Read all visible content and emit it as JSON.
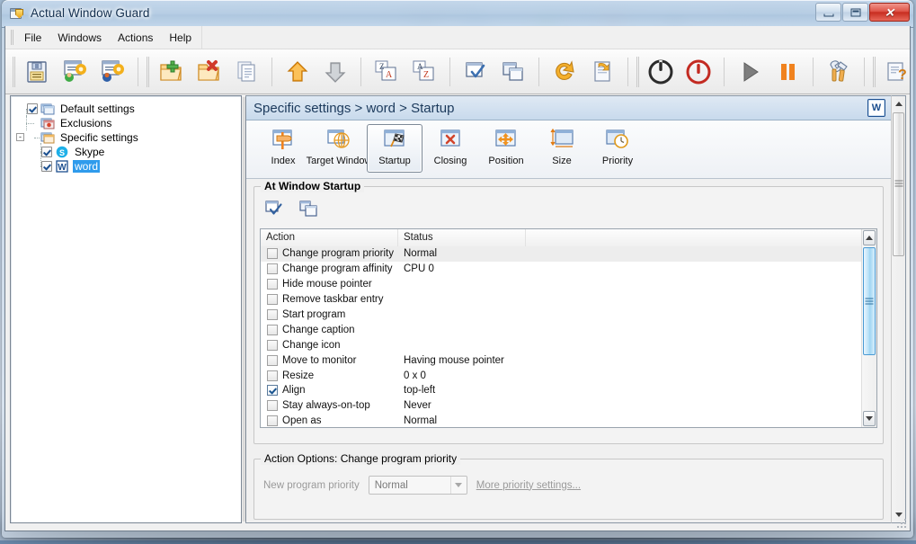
{
  "window": {
    "title": "Actual Window Guard",
    "app_icon": "shield-window-icon",
    "controls": {
      "minimize": "minimize-icon",
      "maximize": "maximize-icon",
      "close": "✕"
    }
  },
  "menubar": {
    "items": [
      "File",
      "Windows",
      "Actions",
      "Help"
    ]
  },
  "toolbar": {
    "groups": [
      {
        "buttons": [
          {
            "name": "save-button",
            "icon": "floppy-disk-icon"
          },
          {
            "name": "default-settings-button",
            "icon": "window-gear-green-icon"
          },
          {
            "name": "specific-settings-button",
            "icon": "window-gear-red-icon"
          }
        ]
      },
      {
        "buttons": [
          {
            "name": "add-rule-button",
            "icon": "folder-plus-icon"
          },
          {
            "name": "delete-rule-button",
            "icon": "folder-delete-icon"
          },
          {
            "name": "copy-rule-button",
            "icon": "copy-pages-icon"
          }
        ]
      },
      {
        "buttons": [
          {
            "name": "move-up-button",
            "icon": "arrow-up-orange-icon"
          },
          {
            "name": "move-down-button",
            "icon": "arrow-down-gray-icon"
          }
        ]
      },
      {
        "buttons": [
          {
            "name": "sort-descending-button",
            "icon": "sort-za-icon"
          },
          {
            "name": "sort-ascending-button",
            "icon": "sort-az-icon"
          }
        ]
      },
      {
        "buttons": [
          {
            "name": "check-all-button",
            "icon": "window-check-icon"
          },
          {
            "name": "uncheck-all-button",
            "icon": "window-copy-icon"
          }
        ]
      },
      {
        "buttons": [
          {
            "name": "undo-button",
            "icon": "undo-arrow-icon"
          },
          {
            "name": "apply-button",
            "icon": "apply-page-icon"
          }
        ]
      },
      {
        "buttons": [
          {
            "name": "enable-button",
            "icon": "power-on-icon"
          },
          {
            "name": "disable-button",
            "icon": "power-off-red-icon"
          }
        ]
      },
      {
        "buttons": [
          {
            "name": "run-button",
            "icon": "play-triangle-icon"
          },
          {
            "name": "pause-button",
            "icon": "pause-bars-icon"
          }
        ]
      },
      {
        "buttons": [
          {
            "name": "tools-button",
            "icon": "hammer-wrench-icon"
          }
        ]
      },
      {
        "buttons": [
          {
            "name": "help-button",
            "icon": "page-question-icon"
          },
          {
            "name": "mail-button",
            "icon": "envelope-green-arrow-icon"
          },
          {
            "name": "support-button",
            "icon": "person-broadcast-icon"
          }
        ]
      }
    ]
  },
  "tree": {
    "nodes": [
      {
        "label": "Default settings",
        "icon": "window-blue-icon",
        "checkbox": "checked",
        "level": 1,
        "expander": "",
        "selected": false
      },
      {
        "label": "Exclusions",
        "icon": "window-red-icon",
        "checkbox": "none",
        "level": 1,
        "expander": "",
        "selected": false
      },
      {
        "label": "Specific settings",
        "icon": "window-orange-icon",
        "checkbox": "none",
        "level": 1,
        "expander": "-",
        "selected": false
      },
      {
        "label": "Skype",
        "icon": "skype-icon",
        "checkbox": "checked",
        "level": 2,
        "expander": "",
        "selected": false
      },
      {
        "label": "word",
        "icon": "word-icon",
        "checkbox": "checked",
        "level": 2,
        "expander": "",
        "selected": true
      }
    ]
  },
  "content": {
    "header_title": "Specific settings > word > Startup",
    "header_badge": "W",
    "tabs": [
      {
        "label": "Index",
        "icon": "window-signpost-icon",
        "active": false
      },
      {
        "label": "Target Window",
        "icon": "window-globe-icon",
        "active": false
      },
      {
        "label": "Startup",
        "icon": "window-flag-icon",
        "active": true
      },
      {
        "label": "Closing",
        "icon": "window-x-icon",
        "active": false
      },
      {
        "label": "Position",
        "icon": "window-move-icon",
        "active": false
      },
      {
        "label": "Size",
        "icon": "window-size-icon",
        "active": false
      },
      {
        "label": "Priority",
        "icon": "window-clock-icon",
        "active": false
      }
    ],
    "startup_group": {
      "legend": "At Window Startup",
      "tools": [
        {
          "name": "check-all-actions-button",
          "icon": "window-check-icon"
        },
        {
          "name": "uncheck-all-actions-button",
          "icon": "window-copy-icon"
        }
      ],
      "columns": [
        "Action",
        "Status",
        ""
      ],
      "rows": [
        {
          "checked": false,
          "action": "Change program priority",
          "status": "Normal",
          "selected": true
        },
        {
          "checked": false,
          "action": "Change program affinity",
          "status": "CPU 0",
          "selected": false
        },
        {
          "checked": false,
          "action": "Hide mouse pointer",
          "status": "",
          "selected": false
        },
        {
          "checked": false,
          "action": "Remove taskbar entry",
          "status": "",
          "selected": false
        },
        {
          "checked": false,
          "action": "Start program",
          "status": "",
          "selected": false
        },
        {
          "checked": false,
          "action": "Change caption",
          "status": "",
          "selected": false
        },
        {
          "checked": false,
          "action": "Change icon",
          "status": "",
          "selected": false
        },
        {
          "checked": false,
          "action": "Move to monitor",
          "status": "Having mouse pointer",
          "selected": false
        },
        {
          "checked": false,
          "action": "Resize",
          "status": "0 x 0",
          "selected": false
        },
        {
          "checked": true,
          "action": "Align",
          "status": "top-left",
          "selected": false
        },
        {
          "checked": false,
          "action": "Stay always-on-top",
          "status": "Never",
          "selected": false
        },
        {
          "checked": false,
          "action": "Open as",
          "status": "Normal",
          "selected": false
        }
      ]
    },
    "options_group": {
      "legend": "Action Options: Change program priority",
      "field_label": "New program priority",
      "field_value": "Normal",
      "link_label": "More priority settings..."
    }
  },
  "colors": {
    "selection_blue": "#2f9bec",
    "header_gradient_top": "#dfe9f4",
    "header_gradient_bottom": "#c8daec",
    "close_button_red": "#c72d20",
    "scrollbar_thumb_blue": "#9fd5f3"
  }
}
